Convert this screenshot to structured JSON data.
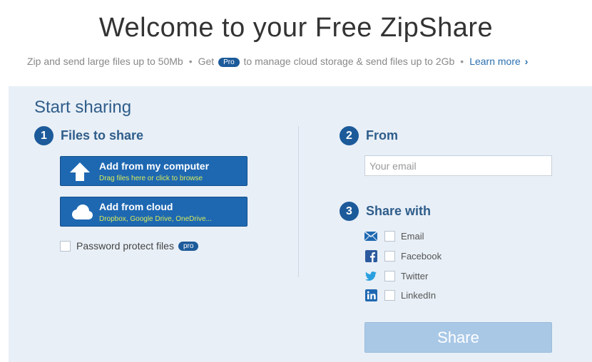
{
  "header": {
    "title": "Welcome to your Free ZipShare",
    "subtitle_part1": "Zip and send large files up to 50Mb",
    "subtitle_sep1": "•",
    "subtitle_get": "Get",
    "pro_badge": "Pro",
    "subtitle_part2": "to manage cloud storage & send files up to 2Gb",
    "subtitle_sep2": "•",
    "learn_more": "Learn more",
    "learn_more_chevron": "›"
  },
  "panel": {
    "section_title": "Start sharing",
    "step1": {
      "number": "1",
      "label": "Files to share"
    },
    "add_computer": {
      "label": "Add from my computer",
      "sub": "Drag files here or click to browse"
    },
    "add_cloud": {
      "label": "Add from cloud",
      "sub": "Dropbox, Google Drive, OneDrive..."
    },
    "password": {
      "label": "Password protect files",
      "badge": "pro"
    },
    "step2": {
      "number": "2",
      "label": "From"
    },
    "email_placeholder": "Your email",
    "step3": {
      "number": "3",
      "label": "Share with"
    },
    "share_options": [
      {
        "label": "Email",
        "icon": "envelope-icon"
      },
      {
        "label": "Facebook",
        "icon": "facebook-icon"
      },
      {
        "label": "Twitter",
        "icon": "twitter-icon"
      },
      {
        "label": "LinkedIn",
        "icon": "linkedin-icon"
      }
    ],
    "share_button": "Share"
  },
  "colors": {
    "accent": "#1e68b2",
    "panel_bg": "#e8eff7",
    "heading": "#2f5d8a",
    "sub_text_green": "#d7eb5a",
    "share_disabled": "#a9c8e6"
  }
}
